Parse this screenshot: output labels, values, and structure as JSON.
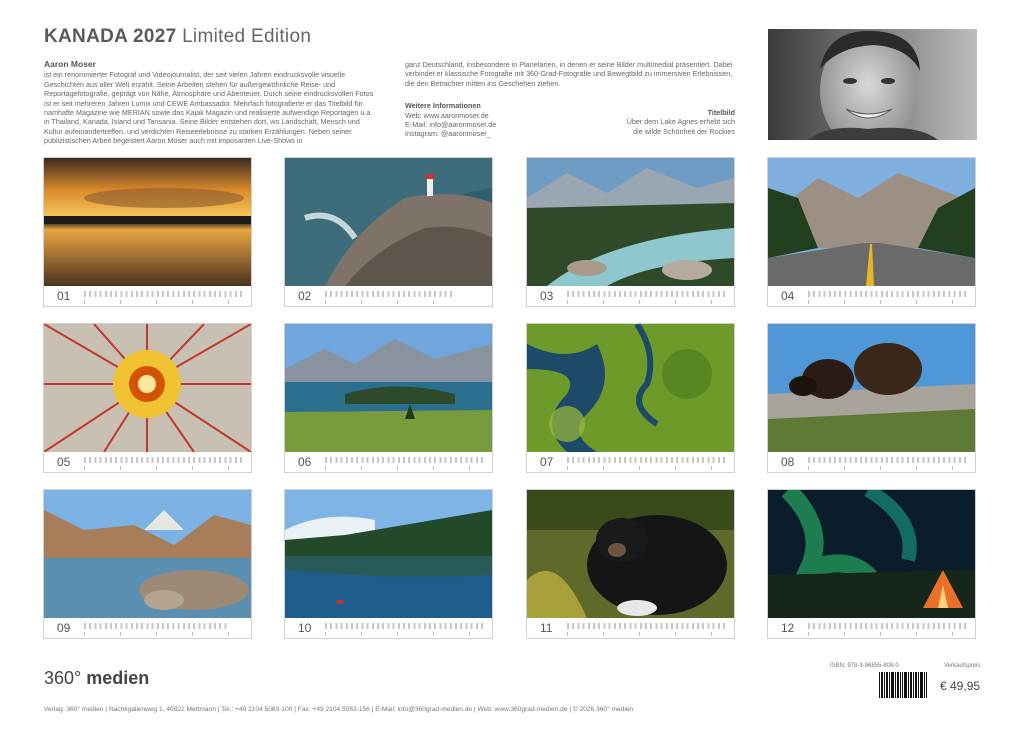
{
  "header": {
    "title_bold": "KANADA 2027",
    "title_light": "Limited Edition"
  },
  "bio": {
    "name": "Aaron Moser",
    "text_left": "ist ein renommierter Fotograf und Videojournalist, der seit vielen Jahren eindrucksvolle visuelle Geschichten aus aller Welt erzählt. Seine Arbeiten stehen für außergewöhnliche Reise- und Reportagefotografie, geprägt von Nähe, Atmosphäre und Abenteuer. Durch seine eindrucksvollen Fotos ist er seit mehreren Jahren Lumix und CEWE Ambassador. Mehrfach fotografierte er das Titelbild für namhafte Magazine wie MERIAN sowie das Kajak Magazin und realisierte aufwendige Reportagen u.a. in Thailand, Kanada, Island und Tansania. Seine Bilder entstehen dort, wo Landschaft, Mensch und Kultur aufeinandertreffen, und verdichten Reiseerlebnisse zu starken Erzählungen. Neben seiner publizistischen Arbeit begeistert Aaron Moser auch mit imposanten Live-Shows in",
    "text_mid": "ganz Deutschland, insbesondere in Planetarien, in denen er seine Bilder multimedial präsentiert. Dabei verbindet er klassische Fotografie mit 360-Grad-Fotografie und Bewegtbild zu immersiven Erlebnissen, die den Betrachter mitten ins Geschehen ziehen.",
    "more_head": "Weitere Informationen",
    "web": "Web: www.aaronmoser.de",
    "email": "E-Mail: info@aaronmoser.de",
    "instagram": "Instagram: @aaronmoser_"
  },
  "titelbild": {
    "head": "Titelbild",
    "line1": "Über dem Lake Agnes erhebt sich",
    "line2": "die wilde Schönheit der Rockies"
  },
  "months": [
    {
      "num": "01",
      "scene": "sunset-lake"
    },
    {
      "num": "02",
      "scene": "lighthouse-coast"
    },
    {
      "num": "03",
      "scene": "mountain-river"
    },
    {
      "num": "04",
      "scene": "mountain-road"
    },
    {
      "num": "05",
      "scene": "dreamcatcher"
    },
    {
      "num": "06",
      "scene": "alpine-lake"
    },
    {
      "num": "07",
      "scene": "aerial-wetland"
    },
    {
      "num": "08",
      "scene": "muskox"
    },
    {
      "num": "09",
      "scene": "lake-louise"
    },
    {
      "num": "10",
      "scene": "kayak-lake"
    },
    {
      "num": "11",
      "scene": "black-bear"
    },
    {
      "num": "12",
      "scene": "aurora-tent"
    }
  ],
  "footer": {
    "logo_num": "360°",
    "logo_word": "medien",
    "address": "Verlag: 360° medien  |  Nachtigallenweg 1, 40822 Mettmann  |  Tel.: +49 2104 5063-100  |  Fax: +49 2104 5063-156  |  E-Mail: info@360grad-medien.de  |  Web: www.360grad-medien.de  |  © 2026 360° medien",
    "isbn": "ISBN: 978-3-96855-808-0",
    "vk_label": "Verkaufspreis",
    "price": "€ 49,95"
  },
  "colors": {
    "text": "#555555",
    "border": "#cfcfcf"
  }
}
